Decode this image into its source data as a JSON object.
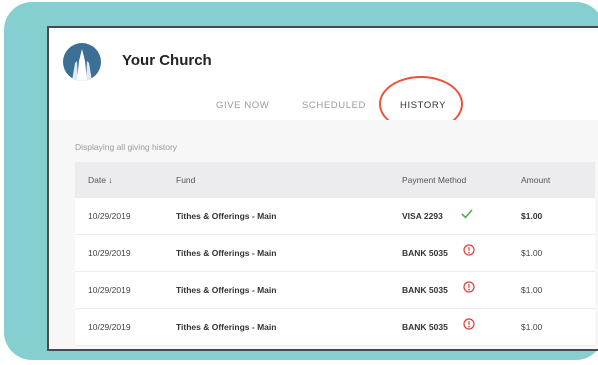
{
  "app": {
    "title": "Your Church"
  },
  "tabs": [
    {
      "label": "GIVE NOW",
      "active": false
    },
    {
      "label": "SCHEDULED",
      "active": false
    },
    {
      "label": "HISTORY",
      "active": true
    }
  ],
  "status": {
    "text": "Displaying all giving history"
  },
  "table": {
    "columns": [
      "Date ↓",
      "Fund",
      "Payment Method",
      "Amount"
    ],
    "rows": [
      {
        "date": "10/29/2019",
        "fund": "Tithes & Offerings - Main",
        "payment": "VISA 2293",
        "status": "success",
        "amount": "$1.00"
      },
      {
        "date": "10/29/2019",
        "fund": "Tithes & Offerings - Main",
        "payment": "BANK 5035",
        "status": "error",
        "amount": "$1.00"
      },
      {
        "date": "10/29/2019",
        "fund": "Tithes & Offerings - Main",
        "payment": "BANK 5035",
        "status": "error",
        "amount": "$1.00"
      },
      {
        "date": "10/29/2019",
        "fund": "Tithes & Offerings - Main",
        "payment": "BANK 5035",
        "status": "error",
        "amount": "$1.00"
      }
    ]
  },
  "icons": {
    "logo": "church-steeple-icon",
    "success": "check-icon",
    "error": "alert-circle-icon"
  },
  "colors": {
    "frame": "#86cfd0",
    "logo_bg": "#3b6f95",
    "highlight": "#e8543a",
    "success": "#4caf50",
    "error": "#e23b3b"
  }
}
